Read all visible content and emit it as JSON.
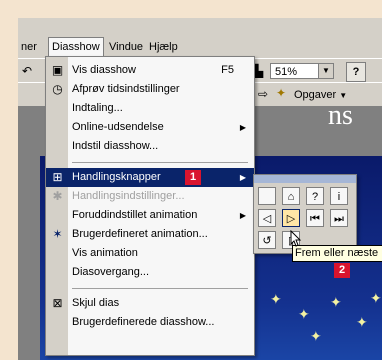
{
  "menubar": {
    "items": [
      "ner",
      "Diasshow",
      "Vindue",
      "Hjælp"
    ]
  },
  "toolbar": {
    "zoom_value": "51%",
    "help_glyph": "?",
    "tasks_label": "Opgaver"
  },
  "slide": {
    "title_fragment": "ns"
  },
  "menu": {
    "items": [
      {
        "label": "Vis diasshow",
        "shortcut": "F5"
      },
      {
        "label": "Afprøv tidsindstillinger"
      },
      {
        "label": "Indtaling..."
      },
      {
        "label": "Online-udsendelse"
      },
      {
        "label": "Indstil diasshow..."
      },
      {
        "label": "Handlingsknapper",
        "badge": "1"
      },
      {
        "label": "Handlingsindstillinger..."
      },
      {
        "label": "Foruddindstillet animation"
      },
      {
        "label": "Brugerdefineret animation..."
      },
      {
        "label": "Vis animation"
      },
      {
        "label": "Diasovergang..."
      },
      {
        "label": "Skjul dias"
      },
      {
        "label": "Brugerdefinerede diasshow..."
      }
    ]
  },
  "submenu": {
    "buttons": [
      "custom",
      "home",
      "help",
      "information",
      "back-or-previous",
      "forward-or-next",
      "beginning",
      "end",
      "return",
      "document"
    ]
  },
  "tooltip": {
    "text": "Frem eller næste",
    "badge": "2"
  },
  "colors": {
    "frame": "#f4e4cf",
    "menu_highlight": "#0a246a",
    "badge": "#d9142e",
    "tooltip_bg": "#ffffe1"
  }
}
